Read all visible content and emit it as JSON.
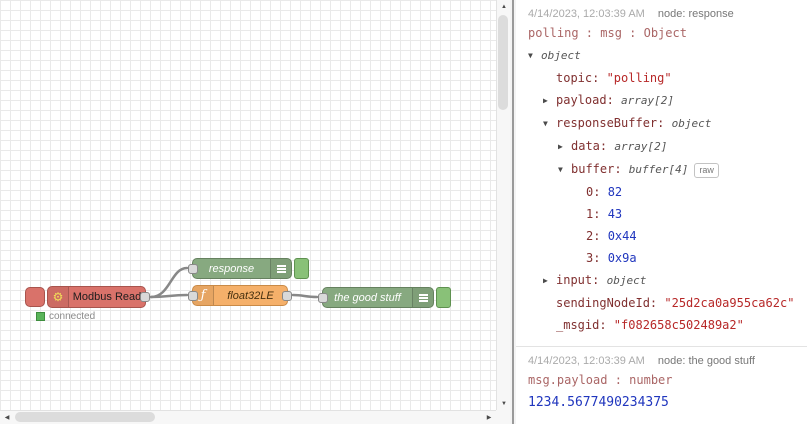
{
  "colors": {
    "debug_node_green": "#87a980",
    "function_node_orange": "#f5b06a",
    "modbus_node_salmon": "#d9726a",
    "wire_gray": "#888888",
    "string_red": "#b72828",
    "number_blue": "#2036be",
    "type_meta_gray": "#555555",
    "key_maroon": "#803030",
    "path_red": "#aa6666",
    "status_green": "#5ab55a"
  },
  "icons": {
    "modbus_gear_icon": "⚙",
    "function_icon": "ƒ",
    "arrow_down": "▼",
    "arrow_right": "▶",
    "scroll_up": "▲",
    "scroll_down": "▼",
    "scroll_left": "◀",
    "scroll_right": "▶"
  },
  "canvas": {
    "modbus": {
      "label": "Modbus Read",
      "status": "connected"
    },
    "response": {
      "label": "response"
    },
    "float32le": {
      "label": "float32LE"
    },
    "good_stuff": {
      "label": "the good stuff"
    }
  },
  "sidebar": {
    "messages": [
      {
        "timestamp": "4/14/2023, 12:03:39 AM",
        "node_ref": "node: response",
        "path": "polling : msg : Object",
        "rows": [
          {
            "indent": 0,
            "arrow": "down",
            "key": null,
            "value": "object",
            "type": "meta"
          },
          {
            "indent": 1,
            "arrow": null,
            "key": "topic",
            "value": "\"polling\"",
            "type": "string"
          },
          {
            "indent": 1,
            "arrow": "right",
            "key": "payload",
            "value": "array[2]",
            "type": "meta"
          },
          {
            "indent": 1,
            "arrow": "down",
            "key": "responseBuffer",
            "value": "object",
            "type": "meta"
          },
          {
            "indent": 2,
            "arrow": "right",
            "key": "data",
            "value": "array[2]",
            "type": "meta"
          },
          {
            "indent": 2,
            "arrow": "down",
            "key": "buffer",
            "value": "buffer[4]",
            "type": "meta",
            "badge": "raw"
          },
          {
            "indent": 3,
            "arrow": null,
            "key": "0",
            "value": "82",
            "type": "number"
          },
          {
            "indent": 3,
            "arrow": null,
            "key": "1",
            "value": "43",
            "type": "number"
          },
          {
            "indent": 3,
            "arrow": null,
            "key": "2",
            "value": "0x44",
            "type": "number"
          },
          {
            "indent": 3,
            "arrow": null,
            "key": "3",
            "value": "0x9a",
            "type": "number"
          },
          {
            "indent": 1,
            "arrow": "right",
            "key": "input",
            "value": "object",
            "type": "meta"
          },
          {
            "indent": 1,
            "arrow": null,
            "key": "sendingNodeId",
            "value": "\"25d2ca0a955ca62c\"",
            "type": "string"
          },
          {
            "indent": 1,
            "arrow": null,
            "key": "_msgid",
            "value": "\"f082658c502489a2\"",
            "type": "string"
          }
        ]
      },
      {
        "timestamp": "4/14/2023, 12:03:39 AM",
        "node_ref": "node: the good stuff",
        "path": "msg.payload : number",
        "value": "1234.5677490234375"
      }
    ]
  }
}
